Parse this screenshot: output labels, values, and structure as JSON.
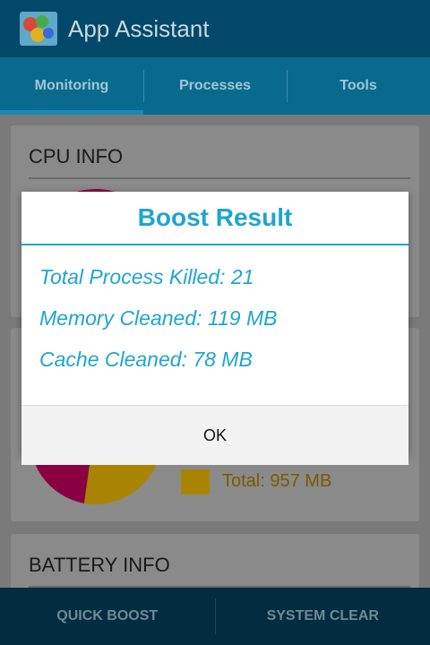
{
  "app": {
    "title": "App Assistant"
  },
  "tabs": [
    {
      "label": "Monitoring",
      "active": true
    },
    {
      "label": "Processes",
      "active": false
    },
    {
      "label": "Tools",
      "active": false
    }
  ],
  "cpu_card": {
    "title": "CPU INFO"
  },
  "memory_card": {
    "legend_total": "Total: 957 MB",
    "colors": {
      "used": "#8a0040",
      "total": "#a88400"
    }
  },
  "battery_card": {
    "title": "BATTERY INFO"
  },
  "bottom_bar": {
    "quick_boost": "QUICK BOOST",
    "system_clear": "SYSTEM CLEAR"
  },
  "dialog": {
    "title": "Boost Result",
    "lines": [
      "Total Process Killed: 21",
      "Memory Cleaned: 119 MB",
      "Cache Cleaned: 78 MB"
    ],
    "ok_label": "OK"
  },
  "colors": {
    "accent": "#1ea5cf",
    "appbar": "#024868",
    "tabs": "#0a6a8e",
    "bottom_bar": "#042c40"
  }
}
